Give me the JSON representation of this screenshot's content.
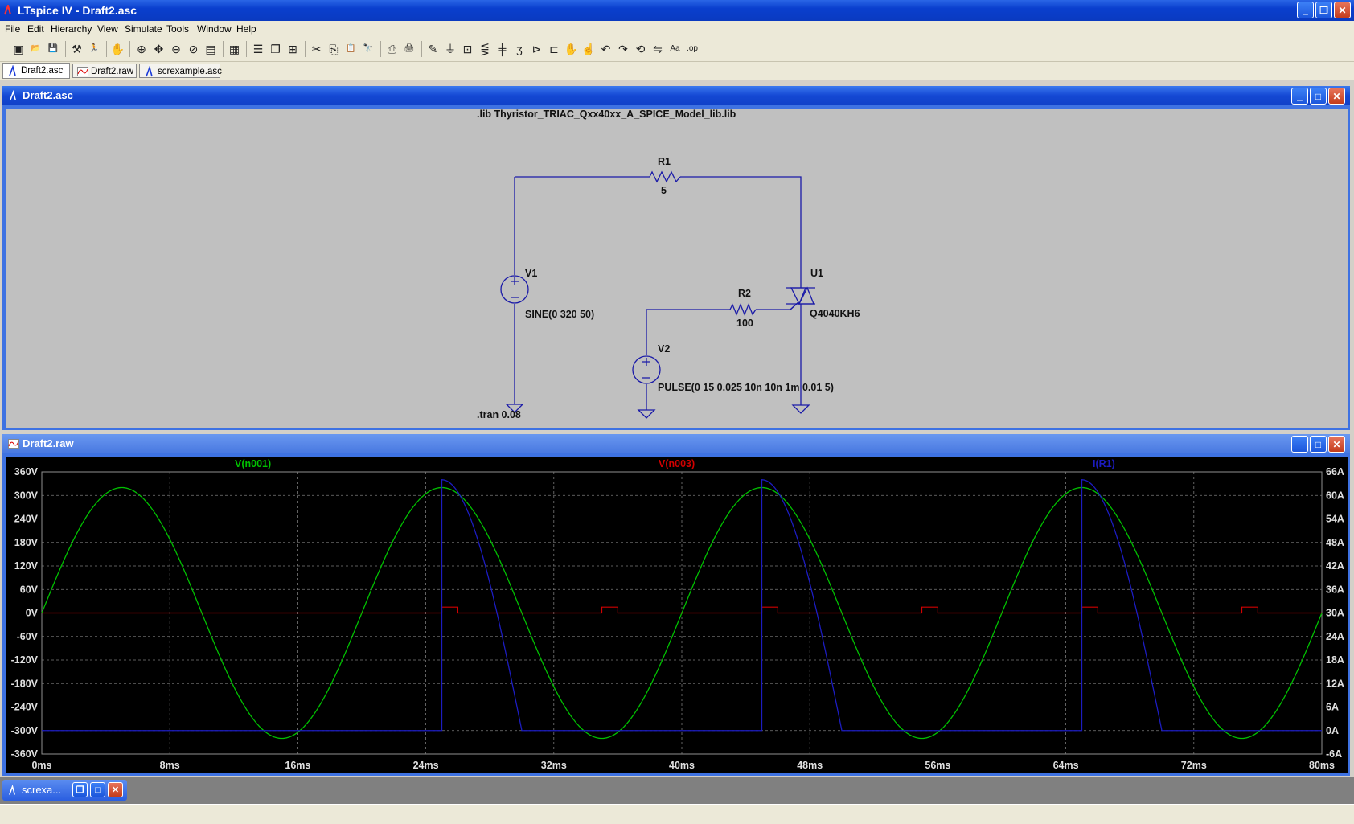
{
  "app": {
    "title": "LTspice IV - Draft2.asc"
  },
  "menu": [
    "File",
    "Edit",
    "Hierarchy",
    "View",
    "Simulate",
    "Tools",
    "Window",
    "Help"
  ],
  "toolbar_icons": [
    "new-schematic-icon",
    "open-icon",
    "save-icon",
    "control-panel-icon",
    "run-icon",
    "halt-icon",
    "zoom-in-icon",
    "pan-icon",
    "zoom-out-icon",
    "zoom-fit-icon",
    "autorange-icon",
    "grid-icon",
    "tile-horizontal-icon",
    "cascade-icon",
    "tile-icon",
    "cut-icon",
    "copy-icon",
    "paste-icon",
    "find-icon",
    "print-setup-icon",
    "print-icon",
    "wire-icon",
    "ground-icon",
    "label-icon",
    "resistor-icon",
    "capacitor-icon",
    "inductor-icon",
    "diode-icon",
    "component-icon",
    "move-icon",
    "drag-icon",
    "undo-icon",
    "redo-icon",
    "rotate-icon",
    "mirror-icon",
    "text-icon",
    "spice-directive-icon"
  ],
  "tabs": [
    {
      "label": "Draft2.asc",
      "kind": "schematic"
    },
    {
      "label": "Draft2.raw",
      "kind": "waveform"
    },
    {
      "label": "screxample.asc",
      "kind": "schematic"
    }
  ],
  "schematic": {
    "title": "Draft2.asc",
    "lib_directive": ".lib Thyristor_TRIAC_Qxx40xx_A_SPICE_Model_lib.lib",
    "tran_directive": ".tran 0.08",
    "R1": {
      "name": "R1",
      "value": "5"
    },
    "R2": {
      "name": "R2",
      "value": "100"
    },
    "V1": {
      "name": "V1",
      "value": "SINE(0 320 50)"
    },
    "V2": {
      "name": "V2",
      "value": "PULSE(0 15 0.025 10n 10n 1m 0.01 5)"
    },
    "U1": {
      "name": "U1",
      "value": "Q4040KH6"
    },
    "wire_color": "#1a1aa8"
  },
  "waveform": {
    "title": "Draft2.raw",
    "traces": [
      {
        "name": "V(n001)",
        "color": "#00c000"
      },
      {
        "name": "V(n003)",
        "color": "#d00000"
      },
      {
        "name": "I(R1)",
        "color": "#1c1cc0"
      }
    ]
  },
  "chart_data": {
    "type": "line",
    "x_ticks": [
      "0ms",
      "8ms",
      "16ms",
      "24ms",
      "32ms",
      "40ms",
      "48ms",
      "56ms",
      "64ms",
      "72ms",
      "80ms"
    ],
    "y_left_ticks": [
      "360V",
      "300V",
      "240V",
      "180V",
      "120V",
      "60V",
      "0V",
      "-60V",
      "-120V",
      "-180V",
      "-240V",
      "-300V",
      "-360V"
    ],
    "y_right_ticks": [
      "66A",
      "60A",
      "54A",
      "48A",
      "42A",
      "36A",
      "30A",
      "24A",
      "18A",
      "12A",
      "6A",
      "0A",
      "-6A"
    ],
    "xlim": [
      0,
      80
    ],
    "ylim_left": [
      -360,
      360
    ],
    "ylim_right": [
      -6,
      66
    ],
    "grid": true,
    "series": [
      {
        "name": "V(n001)",
        "axis": "left",
        "shape": "sine",
        "amplitude": 320,
        "frequency_hz": 50
      },
      {
        "name": "V(n003)",
        "axis": "left",
        "shape": "pulse",
        "low": 0,
        "high": 15,
        "start_ms": 25,
        "width_ms": 1,
        "period_ms": 10
      },
      {
        "name": "I(R1)",
        "axis": "right",
        "shape": "triac-conduction",
        "peak_A": 64,
        "conduction_windows_ms": [
          [
            25,
            30
          ],
          [
            45,
            50
          ],
          [
            65,
            70
          ]
        ]
      }
    ]
  },
  "minimized": {
    "title": "screxa..."
  }
}
